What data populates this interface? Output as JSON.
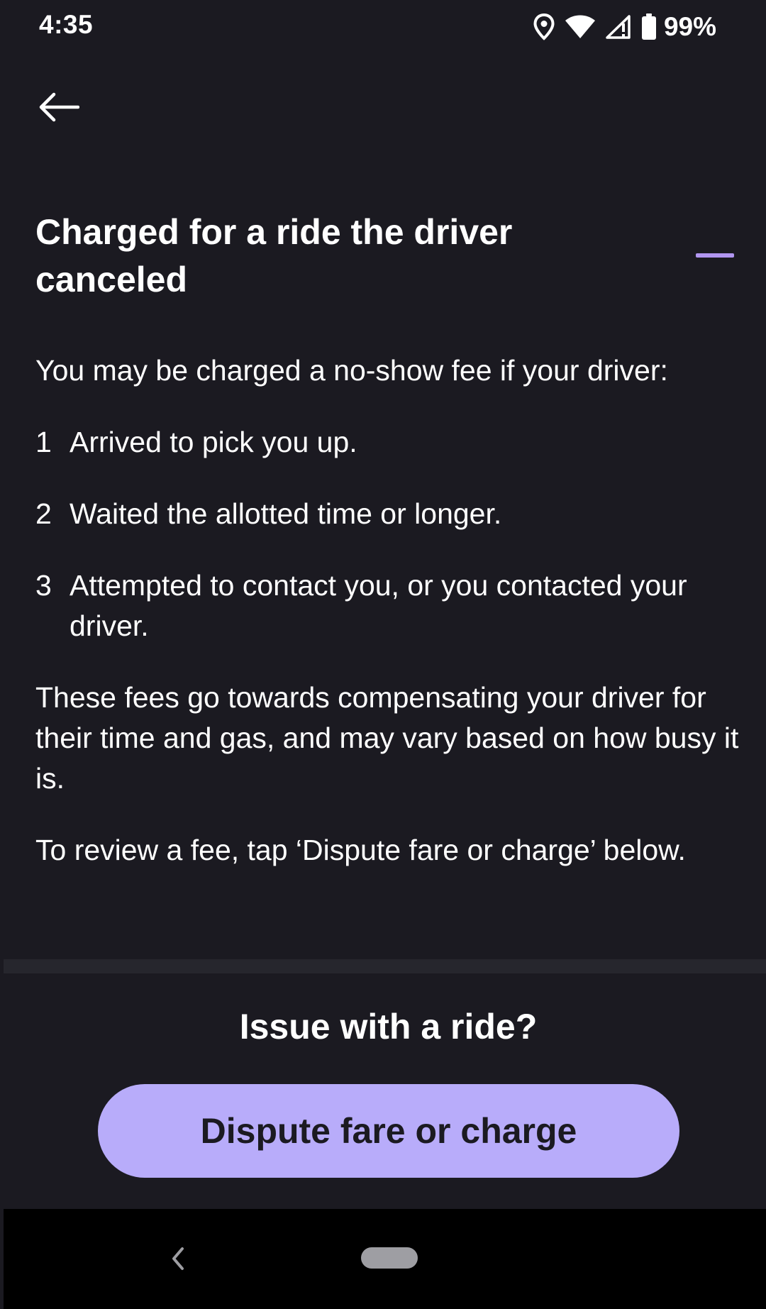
{
  "status_bar": {
    "time": "4:35",
    "battery": "99%",
    "icons": [
      "location-icon",
      "wifi-icon",
      "signal-icon",
      "battery-icon"
    ]
  },
  "toolbar": {
    "back_icon": "arrow-left-icon"
  },
  "article": {
    "title": "Charged for a ride the driver canceled",
    "intro": "You may be charged a no-show fee if your driver:",
    "steps": [
      {
        "number": "1",
        "text": "Arrived to pick you up."
      },
      {
        "number": "2",
        "text": "Waited the allotted time or longer."
      },
      {
        "number": "3",
        "text": "Attempted to contact you, or you contacted your driver."
      }
    ],
    "fees_paragraph": "These fees go towards compensating your driver for their time and gas, and may vary based on how busy it is.",
    "review_paragraph": "To review a fee, tap ‘Dispute fare or charge’ below."
  },
  "issue_section": {
    "heading": "Issue with a ride?",
    "button_label": "Dispute fare or charge"
  },
  "colors": {
    "background": "#1b1a21",
    "accent": "#b196f0",
    "button": "#b8acfa",
    "divider": "#26262d",
    "nav_bar": "#000000"
  }
}
